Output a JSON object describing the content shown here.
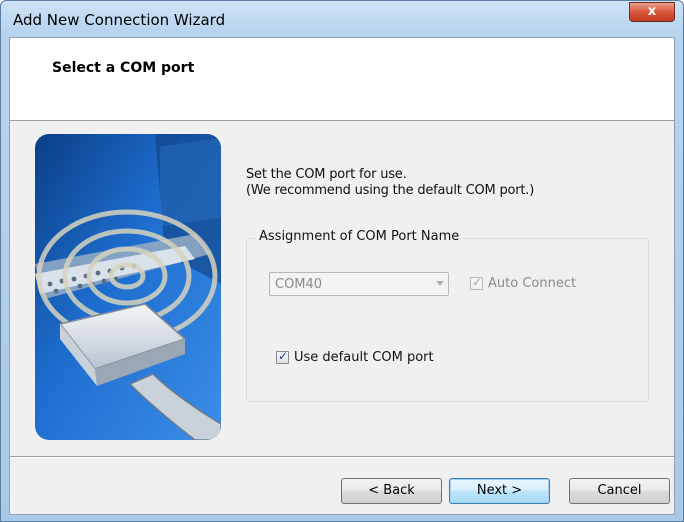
{
  "window": {
    "title": "Add New Connection Wizard",
    "close_label": "x"
  },
  "header": {
    "title": "Select a COM port"
  },
  "description": {
    "line1": "Set the COM port for use.",
    "line2": "(We recommend using the default COM port.)"
  },
  "group": {
    "label": "Assignment of COM Port Name",
    "com_port_select": {
      "value": "COM40",
      "enabled": false
    },
    "auto_connect": {
      "label": "Auto Connect",
      "checked": true,
      "enabled": false
    },
    "use_default": {
      "label": "Use default COM port",
      "checked": true,
      "enabled": true
    }
  },
  "buttons": {
    "back": "< Back",
    "next": "Next >",
    "cancel": "Cancel"
  },
  "illustration": {
    "icon": "serial-port-signal-illustration"
  },
  "colors": {
    "illustration_bg": "#1a5fb4",
    "primary_button_border": "#3c7fb1",
    "close_button": "#d9573b"
  }
}
